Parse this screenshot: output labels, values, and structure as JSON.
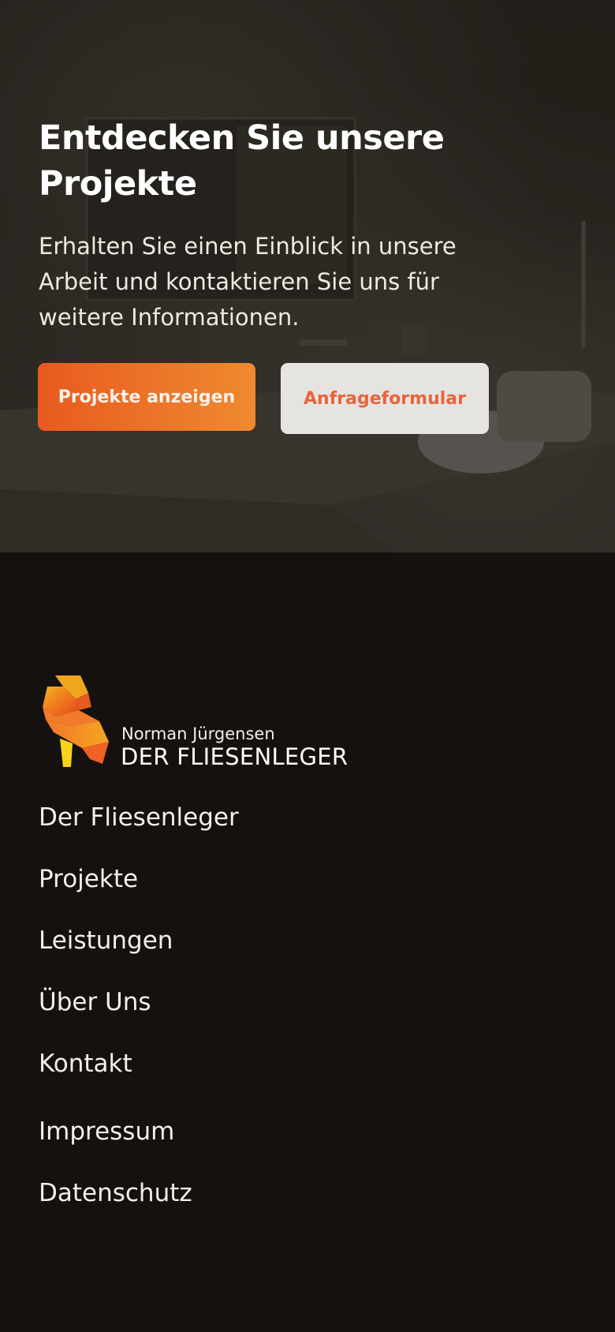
{
  "hero": {
    "title": "Entdecken Sie unsere Projekte",
    "subtitle": "Erhalten Sie einen Einblick in unsere Arbeit und kontaktieren Sie uns für weitere Informationen.",
    "primary_button": "Projekte anzeigen",
    "secondary_button": "Anfrageformular"
  },
  "footer": {
    "logo": {
      "name": "Norman Jürgensen",
      "tagline": "DER FLIESENLEGER",
      "icon": "origami-parrot-icon"
    },
    "nav": [
      {
        "label": "Der Fliesenleger"
      },
      {
        "label": "Projekte"
      },
      {
        "label": "Leistungen"
      },
      {
        "label": "Über Uns"
      },
      {
        "label": "Kontakt"
      },
      {
        "label": "Impressum"
      },
      {
        "label": "Datenschutz"
      }
    ]
  },
  "colors": {
    "accent_start": "#e85a20",
    "accent_end": "#ef8a30",
    "secondary_button_bg": "#e6e4e1",
    "secondary_button_text": "#e8643a",
    "footer_bg": "#15110e"
  }
}
